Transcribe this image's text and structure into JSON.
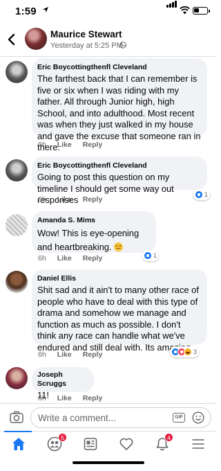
{
  "status_bar": {
    "time": "1:59"
  },
  "header": {
    "name": "Maurice Stewart",
    "timestamp": "Yesterday at 5:25 PM ·"
  },
  "comments": [
    {
      "author": "Eric Boycottingthenfl Cleveland",
      "text": "The farthest back that I can remember is five or six when I was riding with my father. All through Junior high, high School, and into adulthood. Most recent was when they just walked in my house and gave the excuse that someone ran in there.",
      "time": "6h",
      "like": "Like",
      "reply": "Reply",
      "reactions": null
    },
    {
      "author": "Eric Boycottingthenfl Cleveland",
      "text": "Going to post this question on my timeline I should get some way out responses",
      "time": "6h",
      "like": "Like",
      "reply": "Reply",
      "reactions": "1"
    },
    {
      "author": "Amanda S. Mims",
      "text": "Wow! This is eye-opening and heartbreaking.",
      "time": "6h",
      "like": "Like",
      "reply": "Reply",
      "reactions": "1"
    },
    {
      "author": "Daniel Ellis",
      "text": "Shit sad and it ain't to many other race of people who have to deal with this type of drama and somehow we manage and function as much as possible. I don't think any race can handle what we've endured and still deal with. Its amazing",
      "time": "6h",
      "like": "Like",
      "reply": "Reply",
      "reactions": "3"
    },
    {
      "author": "Joseph Scruggs",
      "text": "11!",
      "time": "6h",
      "like": "Like",
      "reply": "Reply",
      "reactions": null
    }
  ],
  "composer": {
    "placeholder": "Write a comment...",
    "gif_label": "GIF"
  },
  "tabbar": {
    "friends_badge": "5",
    "notifications_badge": "4"
  },
  "colors": {
    "accent": "#1877f2",
    "bubble": "#f0f2f5",
    "badge": "#e41e3f"
  },
  "icons": [
    "back-icon",
    "globe-icon",
    "camera-icon",
    "gif-icon",
    "emoji-icon",
    "home-icon",
    "friends-icon",
    "news-icon",
    "dating-icon",
    "notifications-icon",
    "menu-icon"
  ]
}
